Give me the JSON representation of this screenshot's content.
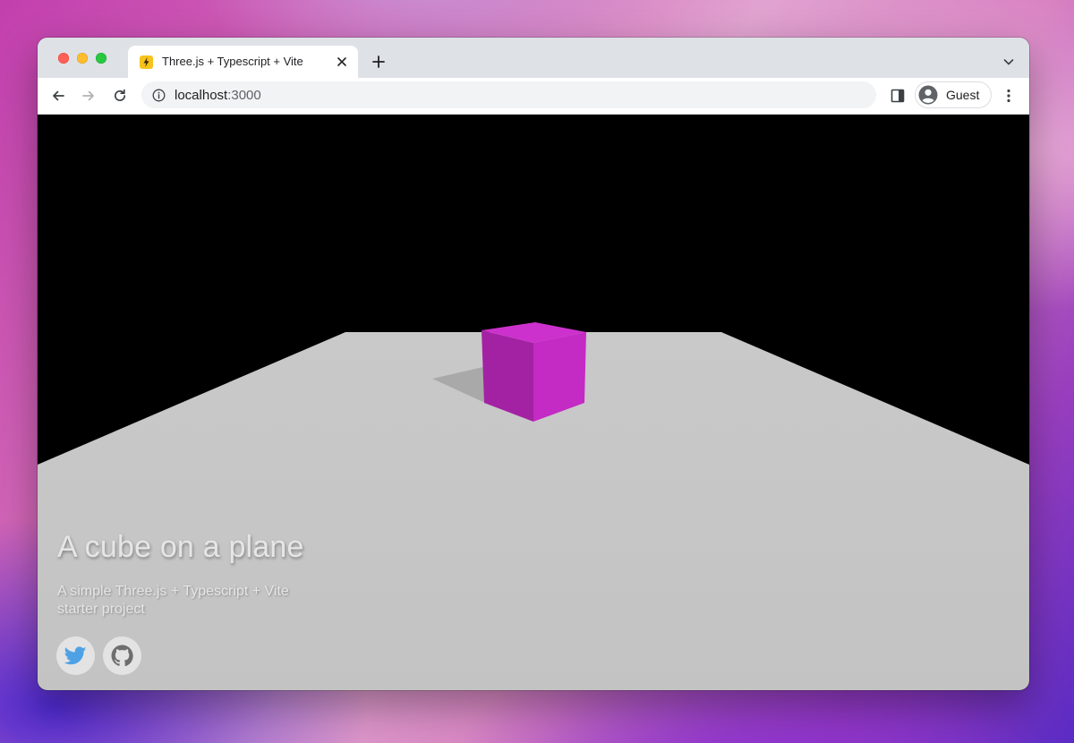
{
  "browser": {
    "tab": {
      "title": "Three.js + Typescript + Vite"
    },
    "address_bar": {
      "host": "localhost",
      "port": ":3000"
    },
    "profile": {
      "label": "Guest"
    }
  },
  "page": {
    "title": "A cube on a plane",
    "description": "A simple Three.js + Typescript + Vite starter project",
    "social_links": [
      {
        "icon": "twitter-icon"
      },
      {
        "icon": "github-icon"
      }
    ]
  },
  "scene": {
    "background_color": "#000000",
    "plane_color": "#c4c4c4",
    "cube_color": "#c42ac4"
  }
}
